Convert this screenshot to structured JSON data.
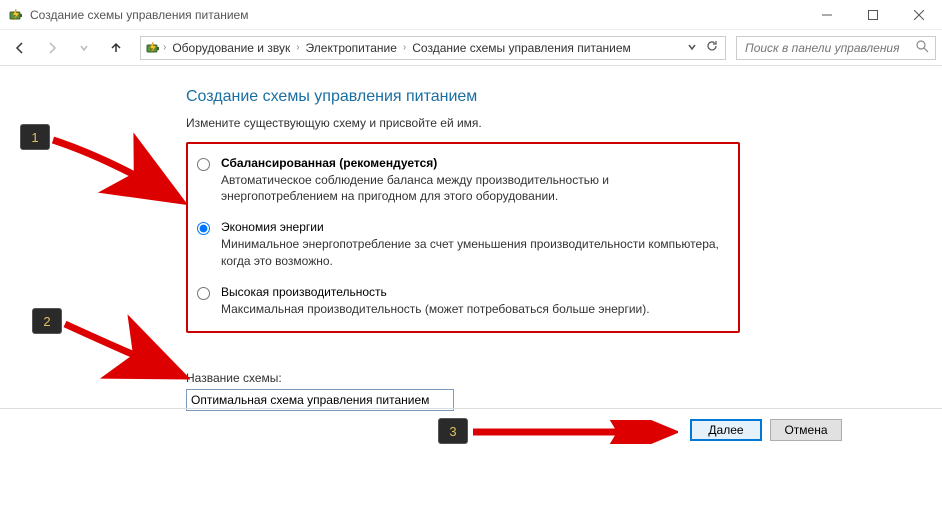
{
  "window": {
    "title": "Создание схемы управления питанием"
  },
  "breadcrumb": {
    "items": [
      "Оборудование и звук",
      "Электропитание",
      "Создание схемы управления питанием"
    ]
  },
  "search": {
    "placeholder": "Поиск в панели управления"
  },
  "page": {
    "heading": "Создание схемы управления питанием",
    "subheading": "Измените существующую схему и присвойте ей имя."
  },
  "options": [
    {
      "title": "Сбалансированная (рекомендуется)",
      "desc": "Автоматическое соблюдение баланса между производительностью и энергопотреблением на пригодном для этого оборудовании.",
      "checked": false
    },
    {
      "title": "Экономия энергии",
      "desc": "Минимальное энергопотребление за счет уменьшения производительности компьютера, когда это возможно.",
      "checked": true
    },
    {
      "title": "Высокая производительность",
      "desc": "Максимальная производительность (может потребоваться больше энергии).",
      "checked": false
    }
  ],
  "plan_name": {
    "label": "Название схемы:",
    "value": "Оптимальная схема управления питанием"
  },
  "buttons": {
    "next": "Далее",
    "cancel": "Отмена"
  },
  "annot": {
    "one": "1",
    "two": "2",
    "three": "3"
  }
}
